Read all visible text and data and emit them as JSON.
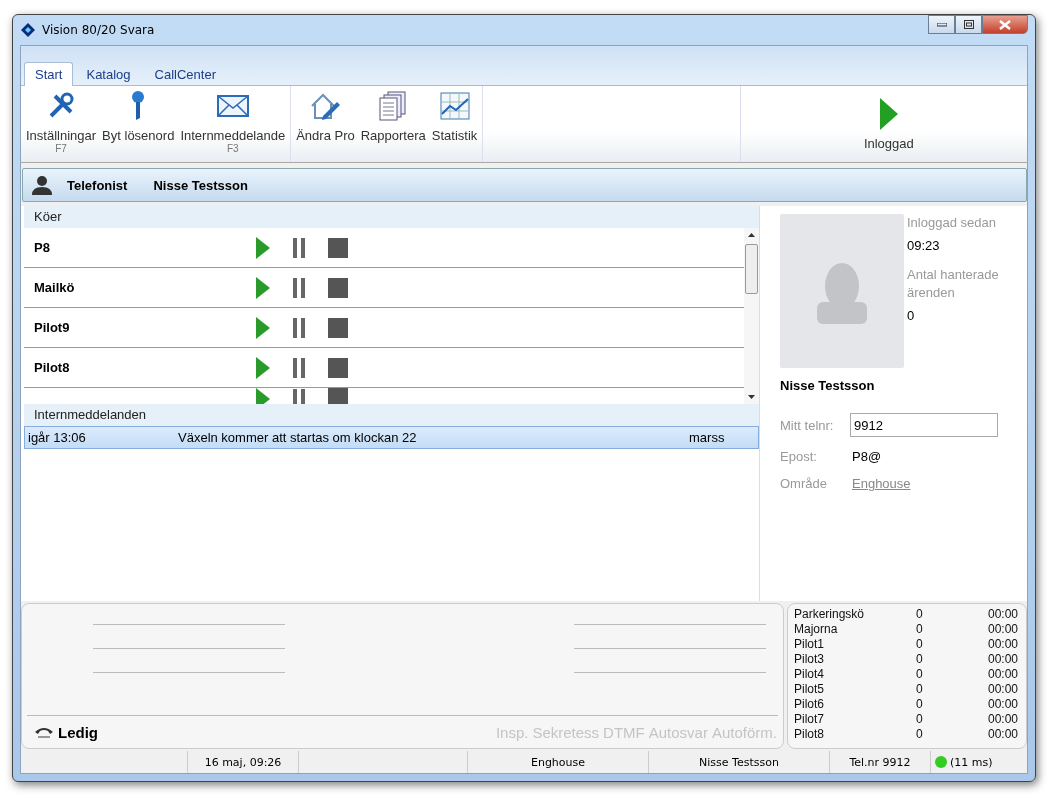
{
  "window": {
    "title": "Vision 80/20 Svara"
  },
  "tabs": [
    {
      "label": "Start",
      "selected": true
    },
    {
      "label": "Katalog",
      "selected": false
    },
    {
      "label": "CallCenter",
      "selected": false
    }
  ],
  "ribbon_groups": [
    {
      "items": [
        {
          "kind": "tools",
          "label": "Inställningar",
          "shortcut": "F7"
        },
        {
          "kind": "key",
          "label": "Byt lösenord"
        },
        {
          "kind": "mail",
          "label": "Internmeddelande",
          "shortcut": "F3"
        }
      ]
    },
    {
      "items": [
        {
          "kind": "house",
          "label": "Ändra Pro"
        },
        {
          "kind": "docs",
          "label": "Rapportera"
        },
        {
          "kind": "chart",
          "label": "Statistik"
        }
      ]
    }
  ],
  "ribbon_right": {
    "kind": "play",
    "label": "Inloggad"
  },
  "user_bar": {
    "role": "Telefonist",
    "name": "Nisse Testsson"
  },
  "queues": {
    "title": "Köer",
    "rows": [
      {
        "name": "P8"
      },
      {
        "name": "Mailkö"
      },
      {
        "name": "Pilot9"
      },
      {
        "name": "Pilot8"
      }
    ]
  },
  "messages": {
    "title": "Internmeddelanden",
    "rows": [
      {
        "time": "igår 13:06",
        "text": "Växeln kommer att startas om klockan 22",
        "sender": "marss",
        "selected": true
      }
    ]
  },
  "profile": {
    "logged_in_label": "Inloggad sedan",
    "logged_in": "09:23",
    "handled_label": "Antal hanterade ärenden",
    "handled": "0",
    "name": "Nisse Testsson",
    "phone_label": "Mitt telnr:",
    "phone": "9912",
    "email_label": "Epost:",
    "email": "P8@",
    "area_label": "Område",
    "area": "Enghouse"
  },
  "call": {
    "status": "Ledig",
    "features": [
      {
        "label": "Insp.",
        "disabled": true
      },
      {
        "label": "Sekretess",
        "disabled": true
      },
      {
        "label": "DTMF",
        "disabled": true
      },
      {
        "label": "Autosvar",
        "disabled": true
      },
      {
        "label": "Autoförm.",
        "disabled": true
      }
    ]
  },
  "queue_stats": [
    {
      "name": "Parkeringskö",
      "count": "0",
      "time": "00:00"
    },
    {
      "name": "Majorna",
      "count": "0",
      "time": "00:00"
    },
    {
      "name": "Pilot1",
      "count": "0",
      "time": "00:00"
    },
    {
      "name": "Pilot3",
      "count": "0",
      "time": "00:00"
    },
    {
      "name": "Pilot4",
      "count": "0",
      "time": "00:00"
    },
    {
      "name": "Pilot5",
      "count": "0",
      "time": "00:00"
    },
    {
      "name": "Pilot6",
      "count": "0",
      "time": "00:00"
    },
    {
      "name": "Pilot7",
      "count": "0",
      "time": "00:00"
    },
    {
      "name": "Pilot8",
      "count": "0",
      "time": "00:00"
    }
  ],
  "status_bar": {
    "date": "16 maj, 09:26",
    "area": "Enghouse",
    "user": "Nisse Testsson",
    "phone": "Tel.nr 9912",
    "connection": {
      "color": "#33cc22",
      "latency": "(11 ms)"
    }
  }
}
